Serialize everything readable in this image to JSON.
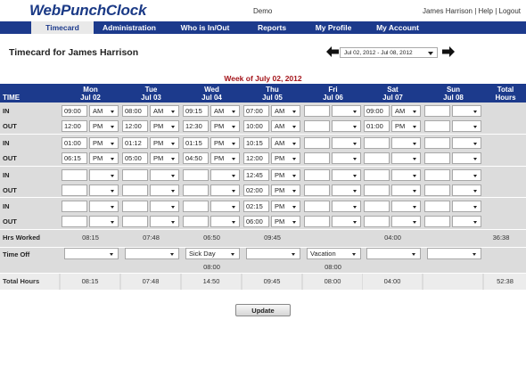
{
  "app": {
    "name": "WebPunchClock",
    "environment": "Demo"
  },
  "user": {
    "name": "James Harrison",
    "help": "Help",
    "logout": "Logout",
    "sep": "|"
  },
  "nav": [
    {
      "label": "Timecard",
      "active": true
    },
    {
      "label": "Administration"
    },
    {
      "label": "Who is In/Out"
    },
    {
      "label": "Reports"
    },
    {
      "label": "My Profile"
    },
    {
      "label": "My Account"
    }
  ],
  "page_title": "Timecard for James Harrison",
  "week_select": {
    "value": "Jul 02, 2012 - Jul 08, 2012"
  },
  "week_label": "Week of July 02, 2012",
  "table": {
    "time_header": "TIME",
    "total_header": [
      "Total",
      "Hours"
    ],
    "days": [
      {
        "dow": "Mon",
        "date": "Jul 02"
      },
      {
        "dow": "Tue",
        "date": "Jul 03"
      },
      {
        "dow": "Wed",
        "date": "Jul 04"
      },
      {
        "dow": "Thu",
        "date": "Jul 05"
      },
      {
        "dow": "Fri",
        "date": "Jul 06"
      },
      {
        "dow": "Sat",
        "date": "Jul 07"
      },
      {
        "dow": "Sun",
        "date": "Jul 08"
      }
    ],
    "in_label": "IN",
    "out_label": "OUT",
    "punch_pairs": [
      {
        "in": [
          [
            "09:00",
            "AM"
          ],
          [
            "08:00",
            "AM"
          ],
          [
            "09:15",
            "AM"
          ],
          [
            "07:00",
            "AM"
          ],
          [
            "",
            ""
          ],
          [
            "09:00",
            "AM"
          ],
          [
            "",
            ""
          ]
        ],
        "out": [
          [
            "12:00",
            "PM"
          ],
          [
            "12:00",
            "PM"
          ],
          [
            "12:30",
            "PM"
          ],
          [
            "10:00",
            "AM"
          ],
          [
            "",
            ""
          ],
          [
            "01:00",
            "PM"
          ],
          [
            "",
            ""
          ]
        ]
      },
      {
        "in": [
          [
            "01:00",
            "PM"
          ],
          [
            "01:12",
            "PM"
          ],
          [
            "01:15",
            "PM"
          ],
          [
            "10:15",
            "AM"
          ],
          [
            "",
            ""
          ],
          [
            "",
            ""
          ],
          [
            "",
            ""
          ]
        ],
        "out": [
          [
            "06:15",
            "PM"
          ],
          [
            "05:00",
            "PM"
          ],
          [
            "04:50",
            "PM"
          ],
          [
            "12:00",
            "PM"
          ],
          [
            "",
            ""
          ],
          [
            "",
            ""
          ],
          [
            "",
            ""
          ]
        ]
      },
      {
        "in": [
          [
            "",
            ""
          ],
          [
            "",
            ""
          ],
          [
            "",
            ""
          ],
          [
            "12:45",
            "PM"
          ],
          [
            "",
            ""
          ],
          [
            "",
            ""
          ],
          [
            "",
            ""
          ]
        ],
        "out": [
          [
            "",
            ""
          ],
          [
            "",
            ""
          ],
          [
            "",
            ""
          ],
          [
            "02:00",
            "PM"
          ],
          [
            "",
            ""
          ],
          [
            "",
            ""
          ],
          [
            "",
            ""
          ]
        ]
      },
      {
        "in": [
          [
            "",
            ""
          ],
          [
            "",
            ""
          ],
          [
            "",
            ""
          ],
          [
            "02:15",
            "PM"
          ],
          [
            "",
            ""
          ],
          [
            "",
            ""
          ],
          [
            "",
            ""
          ]
        ],
        "out": [
          [
            "",
            ""
          ],
          [
            "",
            ""
          ],
          [
            "",
            ""
          ],
          [
            "06:00",
            "PM"
          ],
          [
            "",
            ""
          ],
          [
            "",
            ""
          ],
          [
            "",
            ""
          ]
        ]
      }
    ],
    "hrs_worked_label": "Hrs Worked",
    "hrs_worked": [
      "08:15",
      "07:48",
      "06:50",
      "09:45",
      "",
      "04:00",
      ""
    ],
    "hrs_worked_total": "36:38",
    "time_off_label": "Time Off",
    "time_off": [
      {
        "type": "",
        "hours": ""
      },
      {
        "type": "",
        "hours": ""
      },
      {
        "type": "Sick Day",
        "hours": "08:00"
      },
      {
        "type": "",
        "hours": ""
      },
      {
        "type": "Vacation",
        "hours": "08:00"
      },
      {
        "type": "",
        "hours": ""
      },
      {
        "type": "",
        "hours": ""
      }
    ],
    "total_hours_label": "Total Hours",
    "total_hours": [
      "08:15",
      "07:48",
      "14:50",
      "09:45",
      "08:00",
      "04:00",
      ""
    ],
    "total_hours_total": "52:38"
  },
  "update_button": "Update",
  "colors": {
    "nav_bg": "#1c3a8c",
    "logo": "#1b3a86",
    "week_label": "#a4141a",
    "grid_bg": "#dcdcdc"
  }
}
